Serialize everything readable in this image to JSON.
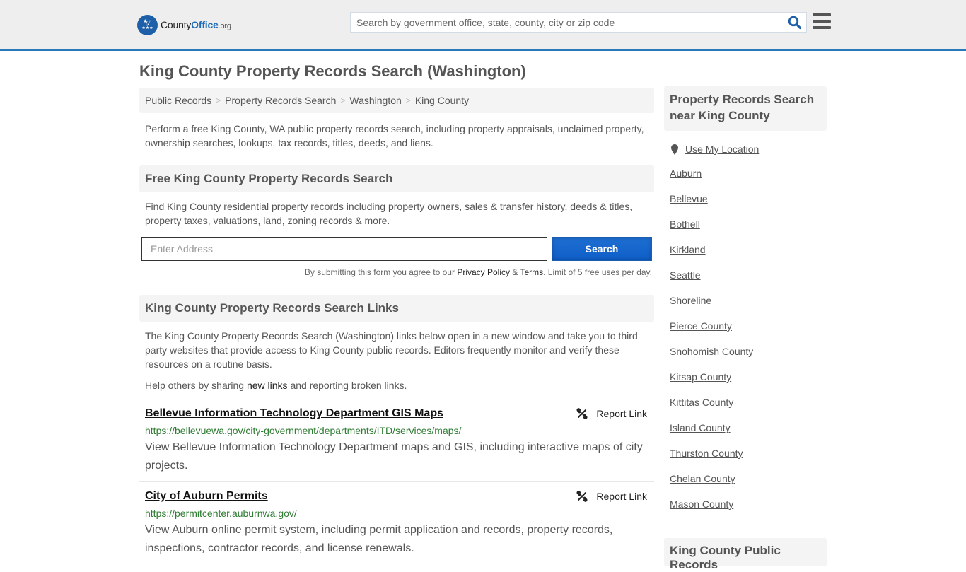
{
  "header": {
    "logo": {
      "brand_part1": "County",
      "brand_part2": "Office",
      "brand_part3": ".org"
    },
    "search": {
      "placeholder": "Search by government office, state, county, city or zip code",
      "value": ""
    },
    "colors": {
      "accent": "#2a78b8",
      "brand_blue": "#1d5fa8"
    }
  },
  "page": {
    "title": "King County Property Records Search (Washington)"
  },
  "breadcrumb": [
    {
      "label": "Public Records"
    },
    {
      "label": "Property Records Search"
    },
    {
      "label": "Washington"
    },
    {
      "label": "King County"
    }
  ],
  "breadcrumb_separator": ">",
  "intro": "Perform a free King County, WA public property records search, including property appraisals, unclaimed property, ownership searches, lookups, tax records, titles, deeds, and liens.",
  "free_search": {
    "heading": "Free King County Property Records Search",
    "description": "Find King County residential property records including property owners, sales & transfer history, deeds & titles, property taxes, valuations, land, zoning records & more.",
    "address_placeholder": "Enter Address",
    "address_value": "",
    "button_label": "Search",
    "terms_prefix": "By submitting this form you agree to our ",
    "privacy_label": "Privacy Policy",
    "terms_and": " & ",
    "terms_label": "Terms",
    "terms_suffix": ". Limit of 5 free uses per day."
  },
  "links_section": {
    "heading": "King County Property Records Search Links",
    "description": "The King County Property Records Search (Washington) links below open in a new window and take you to third party websites that provide access to King County public records. Editors frequently monitor and verify these resources on a routine basis.",
    "help_prefix": "Help others by sharing ",
    "help_link": "new links",
    "help_suffix": " and reporting broken links.",
    "report_label": "Report Link",
    "items": [
      {
        "title": "Bellevue Information Technology Department GIS Maps",
        "url": "https://bellevuewa.gov/city-government/departments/ITD/services/maps/",
        "description": "View Bellevue Information Technology Department maps and GIS, including interactive maps of city projects."
      },
      {
        "title": "City of Auburn Permits",
        "url": "https://permitcenter.auburnwa.gov/",
        "description": "View Auburn online permit system, including permit application and records, property records, inspections, contractor records, and license renewals."
      }
    ]
  },
  "sidebar": {
    "heading": "Property Records Search near King County",
    "use_location": "Use My Location",
    "nearby": [
      {
        "label": "Auburn"
      },
      {
        "label": "Bellevue"
      },
      {
        "label": "Bothell"
      },
      {
        "label": "Kirkland"
      },
      {
        "label": "Seattle"
      },
      {
        "label": "Shoreline"
      },
      {
        "label": "Pierce County"
      },
      {
        "label": "Snohomish County"
      },
      {
        "label": "Kitsap County"
      },
      {
        "label": "Kittitas County"
      },
      {
        "label": "Island County"
      },
      {
        "label": "Thurston County"
      },
      {
        "label": "Chelan County"
      },
      {
        "label": "Mason County"
      }
    ],
    "next_heading": "King County Public Records"
  }
}
